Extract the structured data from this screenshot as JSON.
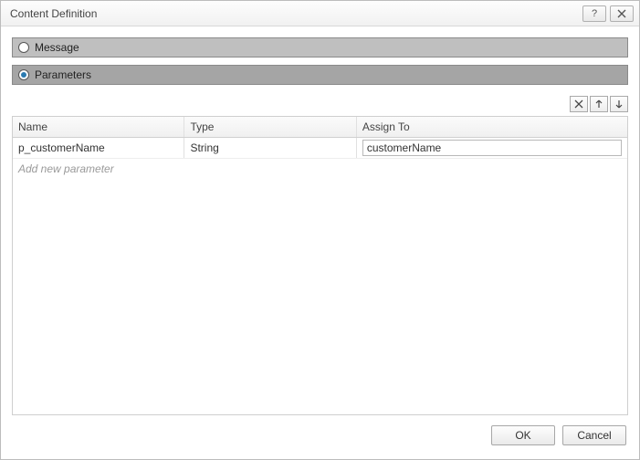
{
  "window": {
    "title": "Content Definition"
  },
  "options": {
    "message_label": "Message",
    "parameters_label": "Parameters",
    "selected": "parameters"
  },
  "grid": {
    "columns": {
      "name": "Name",
      "type": "Type",
      "assign": "Assign To"
    },
    "rows": [
      {
        "name": "p_customerName",
        "type": "String",
        "assign_to": "customerName"
      }
    ],
    "add_placeholder": "Add new parameter"
  },
  "buttons": {
    "ok": "OK",
    "cancel": "Cancel"
  }
}
